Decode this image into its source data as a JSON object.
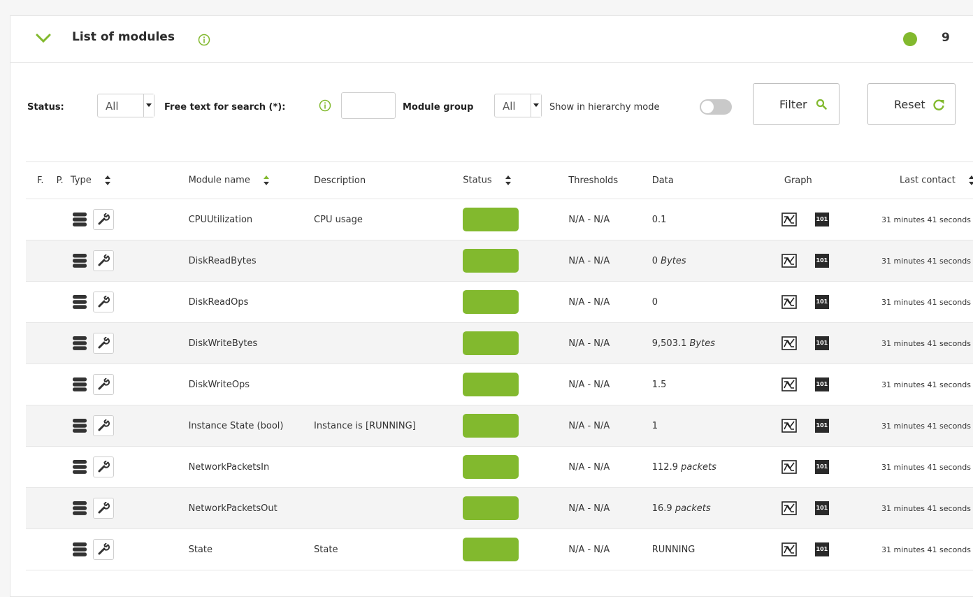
{
  "panel": {
    "title": "List of modules",
    "total_count": "9",
    "status_color": "#82b92e"
  },
  "filters": {
    "status_label": "Status:",
    "status_value": "All",
    "search_label": "Free text for search (*):",
    "search_value": "",
    "group_label": "Module group",
    "group_value": "All",
    "hierarchy_label": "Show in hierarchy mode",
    "hierarchy_on": false,
    "filter_button": "Filter",
    "reset_button": "Reset"
  },
  "columns": {
    "f": "F.",
    "p": "P.",
    "type": "Type",
    "module_name": "Module name",
    "description": "Description",
    "status": "Status",
    "thresholds": "Thresholds",
    "data": "Data",
    "graph": "Graph",
    "last_contact": "Last contact"
  },
  "rows": [
    {
      "name": "CPUUtilization",
      "description": "CPU usage",
      "thresholds": "N/A - N/A",
      "data": "0.1",
      "unit": "",
      "last": "31 minutes 41 seconds"
    },
    {
      "name": "DiskReadBytes",
      "description": "",
      "thresholds": "N/A - N/A",
      "data": "0",
      "unit": "Bytes",
      "last": "31 minutes 41 seconds"
    },
    {
      "name": "DiskReadOps",
      "description": "",
      "thresholds": "N/A - N/A",
      "data": "0",
      "unit": "",
      "last": "31 minutes 41 seconds"
    },
    {
      "name": "DiskWriteBytes",
      "description": "",
      "thresholds": "N/A - N/A",
      "data": "9,503.1",
      "unit": "Bytes",
      "last": "31 minutes 41 seconds"
    },
    {
      "name": "DiskWriteOps",
      "description": "",
      "thresholds": "N/A - N/A",
      "data": "1.5",
      "unit": "",
      "last": "31 minutes 41 seconds"
    },
    {
      "name": "Instance State (bool)",
      "description": "Instance is [RUNNING]",
      "thresholds": "N/A - N/A",
      "data": "1",
      "unit": "",
      "last": "31 minutes 41 seconds"
    },
    {
      "name": "NetworkPacketsIn",
      "description": "",
      "thresholds": "N/A - N/A",
      "data": "112.9",
      "unit": "packets",
      "last": "31 minutes 41 seconds"
    },
    {
      "name": "NetworkPacketsOut",
      "description": "",
      "thresholds": "N/A - N/A",
      "data": "16.9",
      "unit": "packets",
      "last": "31 minutes 41 seconds"
    },
    {
      "name": "State",
      "description": "State",
      "thresholds": "N/A - N/A",
      "data": "RUNNING",
      "unit": "",
      "last": "31 minutes 41 seconds"
    }
  ],
  "raw_icon_label": "101",
  "icons": {
    "collapse": "chevron-down-icon",
    "info": "info-icon",
    "type": "database-icon",
    "module_type": "wrench-icon",
    "graph": "graph-icon",
    "raw": "raw-data-icon",
    "filter": "search-icon",
    "reset": "refresh-icon"
  }
}
